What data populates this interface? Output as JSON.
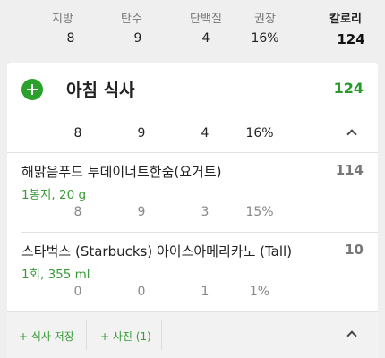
{
  "summary": {
    "headers": [
      "지방",
      "탄수",
      "단백질",
      "권장",
      "칼로리"
    ],
    "values": [
      "8",
      "9",
      "4",
      "16%",
      "124"
    ]
  },
  "meal": {
    "title": "아침 식사",
    "calories": "124",
    "totals": [
      "8",
      "9",
      "4",
      "16%"
    ]
  },
  "foods": [
    {
      "name": "해맑음푸드 투데이너트한줌(요거트)",
      "calories": "114",
      "serving": "1봉지, 20 g",
      "nutrients": [
        "8",
        "9",
        "3",
        "15%"
      ]
    },
    {
      "name": "스타벅스 (Starbucks) 아이스아메리카노 (Tall)",
      "calories": "10",
      "serving": "1회, 355 ml",
      "nutrients": [
        "0",
        "0",
        "1",
        "1%"
      ]
    }
  ],
  "footer": {
    "save_meal_label": "+ 식사 저장",
    "photo_label": "+ 사진 (1)"
  },
  "colors": {
    "accent_green": "#2ca02c",
    "background": "#efefef"
  },
  "icons": {
    "add_meal": "plus-circle-icon",
    "collapse": "chevron-up-icon"
  }
}
